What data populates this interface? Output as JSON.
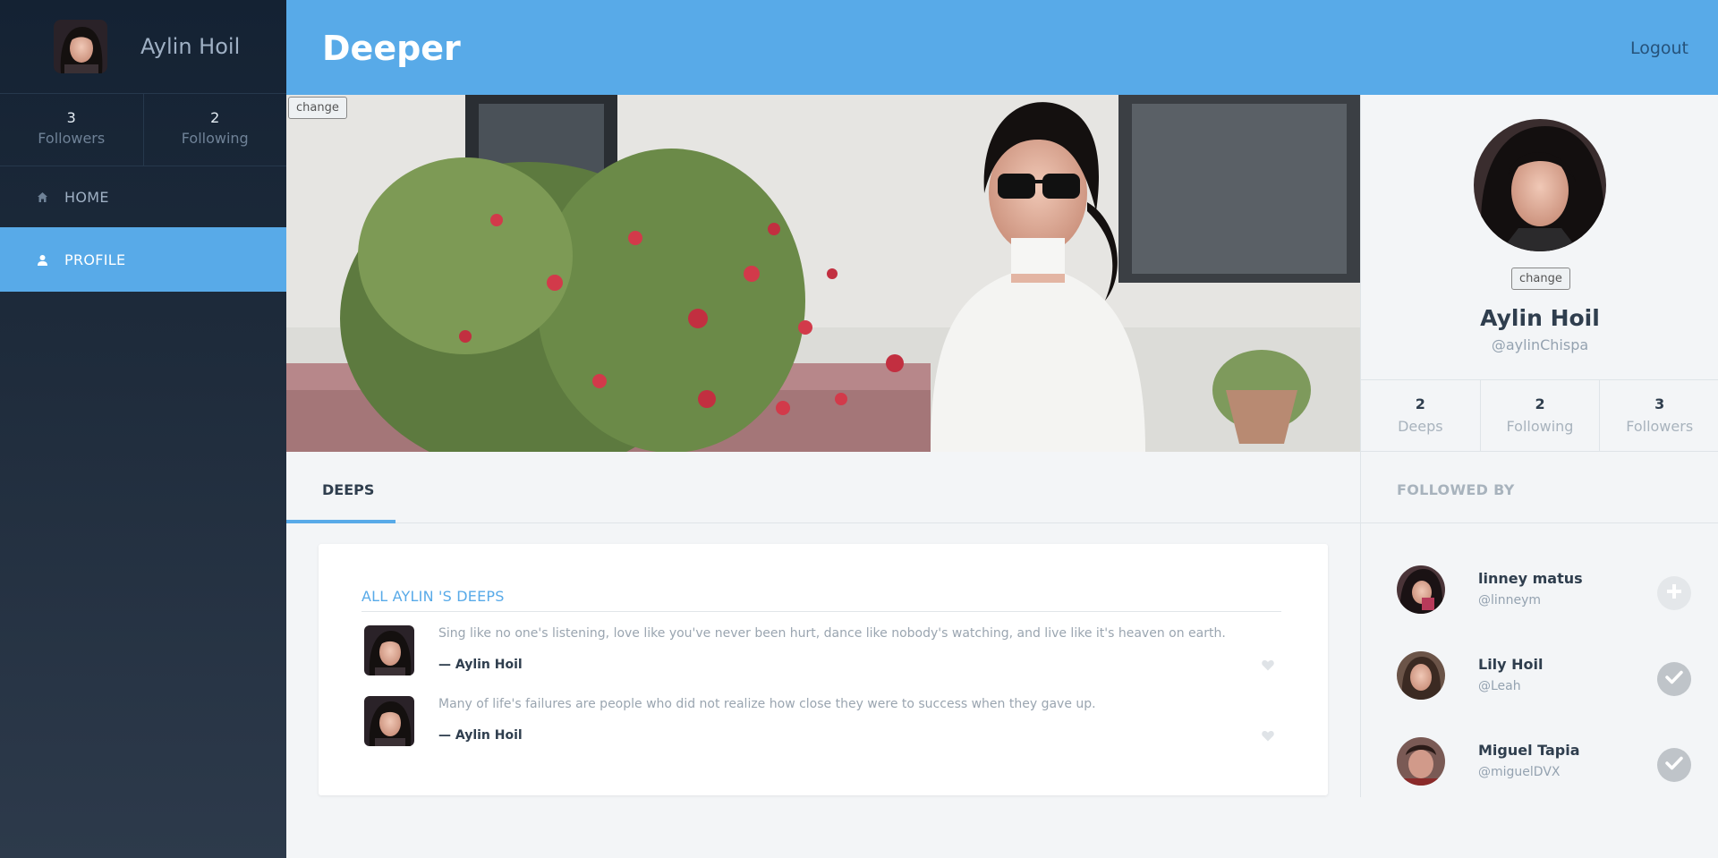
{
  "sidebar": {
    "user_name": "Aylin Hoil",
    "stats": [
      {
        "value": "3",
        "label": "Followers"
      },
      {
        "value": "2",
        "label": "Following"
      }
    ],
    "nav": [
      {
        "label": "HOME",
        "icon": "home-icon"
      },
      {
        "label": "PROFILE",
        "icon": "user-icon",
        "active": true
      }
    ]
  },
  "header": {
    "brand": "Deeper",
    "logout": "Logout"
  },
  "cover": {
    "change_label": "change"
  },
  "profile": {
    "change_label": "change",
    "name": "Aylin Hoil",
    "handle": "@aylinChispa",
    "stats": [
      {
        "value": "2",
        "label": "Deeps"
      },
      {
        "value": "2",
        "label": "Following"
      },
      {
        "value": "3",
        "label": "Followers"
      }
    ]
  },
  "followed_by": {
    "title": "FOLLOWED BY",
    "users": [
      {
        "name": "linney matus",
        "handle": "@linneym",
        "following": false
      },
      {
        "name": "Lily Hoil",
        "handle": "@Leah",
        "following": true
      },
      {
        "name": "Miguel Tapia",
        "handle": "@miguelDVX",
        "following": true
      }
    ]
  },
  "tabs": [
    {
      "label": "DEEPS",
      "active": true
    }
  ],
  "deeps_card": {
    "title": "ALL AYLIN 'S DEEPS",
    "items": [
      {
        "text": "Sing like no one's listening, love like you've never been hurt, dance like nobody's watching, and live like it's heaven on earth.",
        "author": "— Aylin Hoil"
      },
      {
        "text": "Many of life's failures are people who did not realize how close they were to success when they gave up.",
        "author": "— Aylin Hoil"
      }
    ]
  },
  "colors": {
    "accent": "#58aae8",
    "sidebar_top": "#142233",
    "sidebar_bottom": "#2d3a4b",
    "follow_check": "#bfc4c9",
    "follow_add": "#e4e7ea"
  }
}
